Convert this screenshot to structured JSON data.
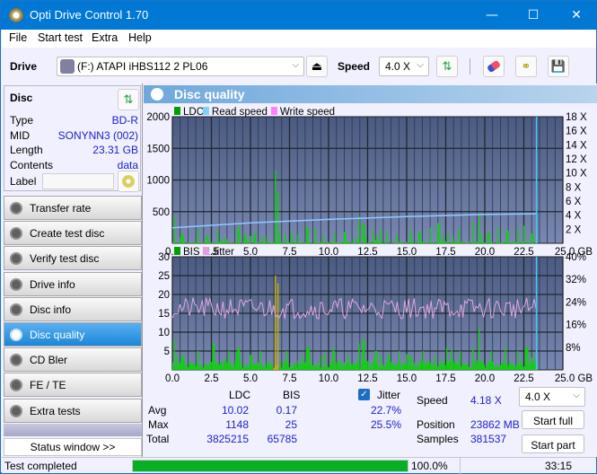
{
  "window": {
    "title": "Opti Drive Control 1.70",
    "minimize": "—",
    "maximize": "☐",
    "close": "✕"
  },
  "menu": [
    "File",
    "Start test",
    "Extra",
    "Help"
  ],
  "toolbar": {
    "drive_label": "Drive",
    "drive_value": "(F:)  ATAPI iHBS112  2 PL06",
    "speed_label": "Speed",
    "speed_value": "4.0 X",
    "icons": [
      "eject-icon",
      "refresh-icon",
      "erase-icon",
      "copy-icon",
      "save-icon"
    ]
  },
  "disc": {
    "header": "Disc",
    "type_label": "Type",
    "type_value": "BD-R",
    "mid_label": "MID",
    "mid_value": "SONYNN3 (002)",
    "length_label": "Length",
    "length_value": "23.31 GB",
    "contents_label": "Contents",
    "contents_value": "data",
    "label_label": "Label",
    "label_value": ""
  },
  "nav": [
    {
      "label": "Transfer rate",
      "active": false
    },
    {
      "label": "Create test disc",
      "active": false
    },
    {
      "label": "Verify test disc",
      "active": false
    },
    {
      "label": "Drive info",
      "active": false
    },
    {
      "label": "Disc info",
      "active": false
    },
    {
      "label": "Disc quality",
      "active": true
    },
    {
      "label": "CD Bler",
      "active": false
    },
    {
      "label": "FE / TE",
      "active": false
    },
    {
      "label": "Extra tests",
      "active": false
    }
  ],
  "status_window_button": "Status window >>",
  "panel_title": "Disc quality",
  "stats": {
    "col_ldc": "LDC",
    "col_bis": "BIS",
    "jitter_label": "Jitter",
    "jitter_checked": true,
    "avg_label": "Avg",
    "avg_ldc": "10.02",
    "avg_bis": "0.17",
    "avg_jitter": "22.7%",
    "max_label": "Max",
    "max_ldc": "1148",
    "max_bis": "25",
    "max_jitter": "25.5%",
    "total_label": "Total",
    "total_ldc": "3825215",
    "total_bis": "65785",
    "speed_label": "Speed",
    "speed_value": "4.18 X",
    "position_label": "Position",
    "position_value": "23862 MB",
    "samples_label": "Samples",
    "samples_value": "381537",
    "speed_select": "4.0 X",
    "start_full": "Start full",
    "start_part": "Start part"
  },
  "statusbar": {
    "text": "Test completed",
    "progress": 100.0,
    "progress_text": "100.0%",
    "time": "33:15"
  },
  "chart_data": [
    {
      "type": "bar",
      "title": "LDC",
      "legend": [
        "LDC",
        "Read speed",
        "Write speed"
      ],
      "legend_colors": [
        "#00a000",
        "#80d0ff",
        "#ff80ff"
      ],
      "legend_placement": "top-left",
      "xlabel": "GB",
      "xlim": [
        0,
        25
      ],
      "x_ticks": [
        "0.0",
        "2.5",
        "5.0",
        "7.5",
        "10.0",
        "12.5",
        "15.0",
        "17.5",
        "20.0",
        "22.5",
        "25.0 GB"
      ],
      "ylim": [
        0,
        2000
      ],
      "y_ticks": [
        "500",
        "1000",
        "1500",
        "2000"
      ],
      "y2lim": [
        0,
        18
      ],
      "y2_ticks": [
        "2 X",
        "4 X",
        "6 X",
        "8 X",
        "10 X",
        "12 X",
        "14 X",
        "16 X",
        "18 X"
      ],
      "end_marker_x": 23.31,
      "ldc_peaks": [
        [
          0.05,
          420
        ],
        [
          0.6,
          150
        ],
        [
          1.6,
          230
        ],
        [
          2.2,
          120
        ],
        [
          2.9,
          200
        ],
        [
          3.3,
          80
        ],
        [
          4.2,
          260
        ],
        [
          4.6,
          140
        ],
        [
          5.3,
          180
        ],
        [
          6.0,
          100
        ],
        [
          6.55,
          1148
        ],
        [
          6.7,
          800
        ],
        [
          7.2,
          150
        ],
        [
          8.0,
          140
        ],
        [
          8.6,
          260
        ],
        [
          9.1,
          240
        ],
        [
          9.6,
          120
        ],
        [
          10.3,
          160
        ],
        [
          11.0,
          180
        ],
        [
          11.9,
          420
        ],
        [
          12.2,
          300
        ],
        [
          12.8,
          200
        ],
        [
          13.3,
          230
        ],
        [
          13.7,
          170
        ],
        [
          14.3,
          130
        ],
        [
          15.2,
          220
        ],
        [
          15.8,
          180
        ],
        [
          16.5,
          250
        ],
        [
          17.0,
          320
        ],
        [
          17.6,
          170
        ],
        [
          18.3,
          230
        ],
        [
          19.2,
          340
        ],
        [
          19.6,
          450
        ],
        [
          20.2,
          180
        ],
        [
          20.8,
          260
        ],
        [
          21.4,
          200
        ],
        [
          22.1,
          230
        ],
        [
          22.5,
          280
        ],
        [
          23.0,
          150
        ]
      ],
      "read_speed": [
        [
          0,
          2.2
        ],
        [
          5,
          2.9
        ],
        [
          10,
          3.4
        ],
        [
          15,
          3.8
        ],
        [
          20,
          4.1
        ],
        [
          23.31,
          4.2
        ]
      ]
    },
    {
      "type": "bar",
      "title": "BIS",
      "legend": [
        "BIS",
        "Jitter"
      ],
      "legend_colors": [
        "#00a000",
        "#e0a0e0"
      ],
      "legend_placement": "top-left",
      "xlabel": "GB",
      "xlim": [
        0,
        25
      ],
      "x_ticks": [
        "0.0",
        "2.5",
        "5.0",
        "7.5",
        "10.0",
        "12.5",
        "15.0",
        "17.5",
        "20.0",
        "22.5",
        "25.0 GB"
      ],
      "ylim": [
        0,
        30
      ],
      "y_ticks": [
        "5",
        "10",
        "15",
        "20",
        "25",
        "30"
      ],
      "y2lim": [
        0,
        40
      ],
      "y2_ticks": [
        "8%",
        "16%",
        "24%",
        "32%",
        "40%"
      ],
      "end_marker_x": 23.31,
      "bis_peaks": [
        [
          0.05,
          8
        ],
        [
          0.6,
          4
        ],
        [
          1.6,
          5
        ],
        [
          2.6,
          7
        ],
        [
          3.3,
          3
        ],
        [
          4.2,
          6
        ],
        [
          5.0,
          4
        ],
        [
          5.6,
          5
        ],
        [
          6.55,
          25
        ],
        [
          6.7,
          23
        ],
        [
          7.3,
          5
        ],
        [
          8.3,
          4
        ],
        [
          8.6,
          6
        ],
        [
          9.5,
          4
        ],
        [
          10.3,
          5
        ],
        [
          11.2,
          4
        ],
        [
          11.9,
          7
        ],
        [
          12.2,
          8
        ],
        [
          13.0,
          5
        ],
        [
          13.8,
          4
        ],
        [
          14.5,
          5
        ],
        [
          15.2,
          4
        ],
        [
          16.0,
          5
        ],
        [
          16.8,
          4
        ],
        [
          17.5,
          6
        ],
        [
          18.4,
          5
        ],
        [
          19.2,
          6
        ],
        [
          19.6,
          11
        ],
        [
          20.4,
          5
        ],
        [
          21.3,
          6
        ],
        [
          22.1,
          5
        ],
        [
          22.6,
          6
        ],
        [
          23.1,
          4
        ]
      ],
      "jitter_range_pct": [
        18,
        25.5
      ],
      "jitter_avg_pct": 22.7
    }
  ]
}
